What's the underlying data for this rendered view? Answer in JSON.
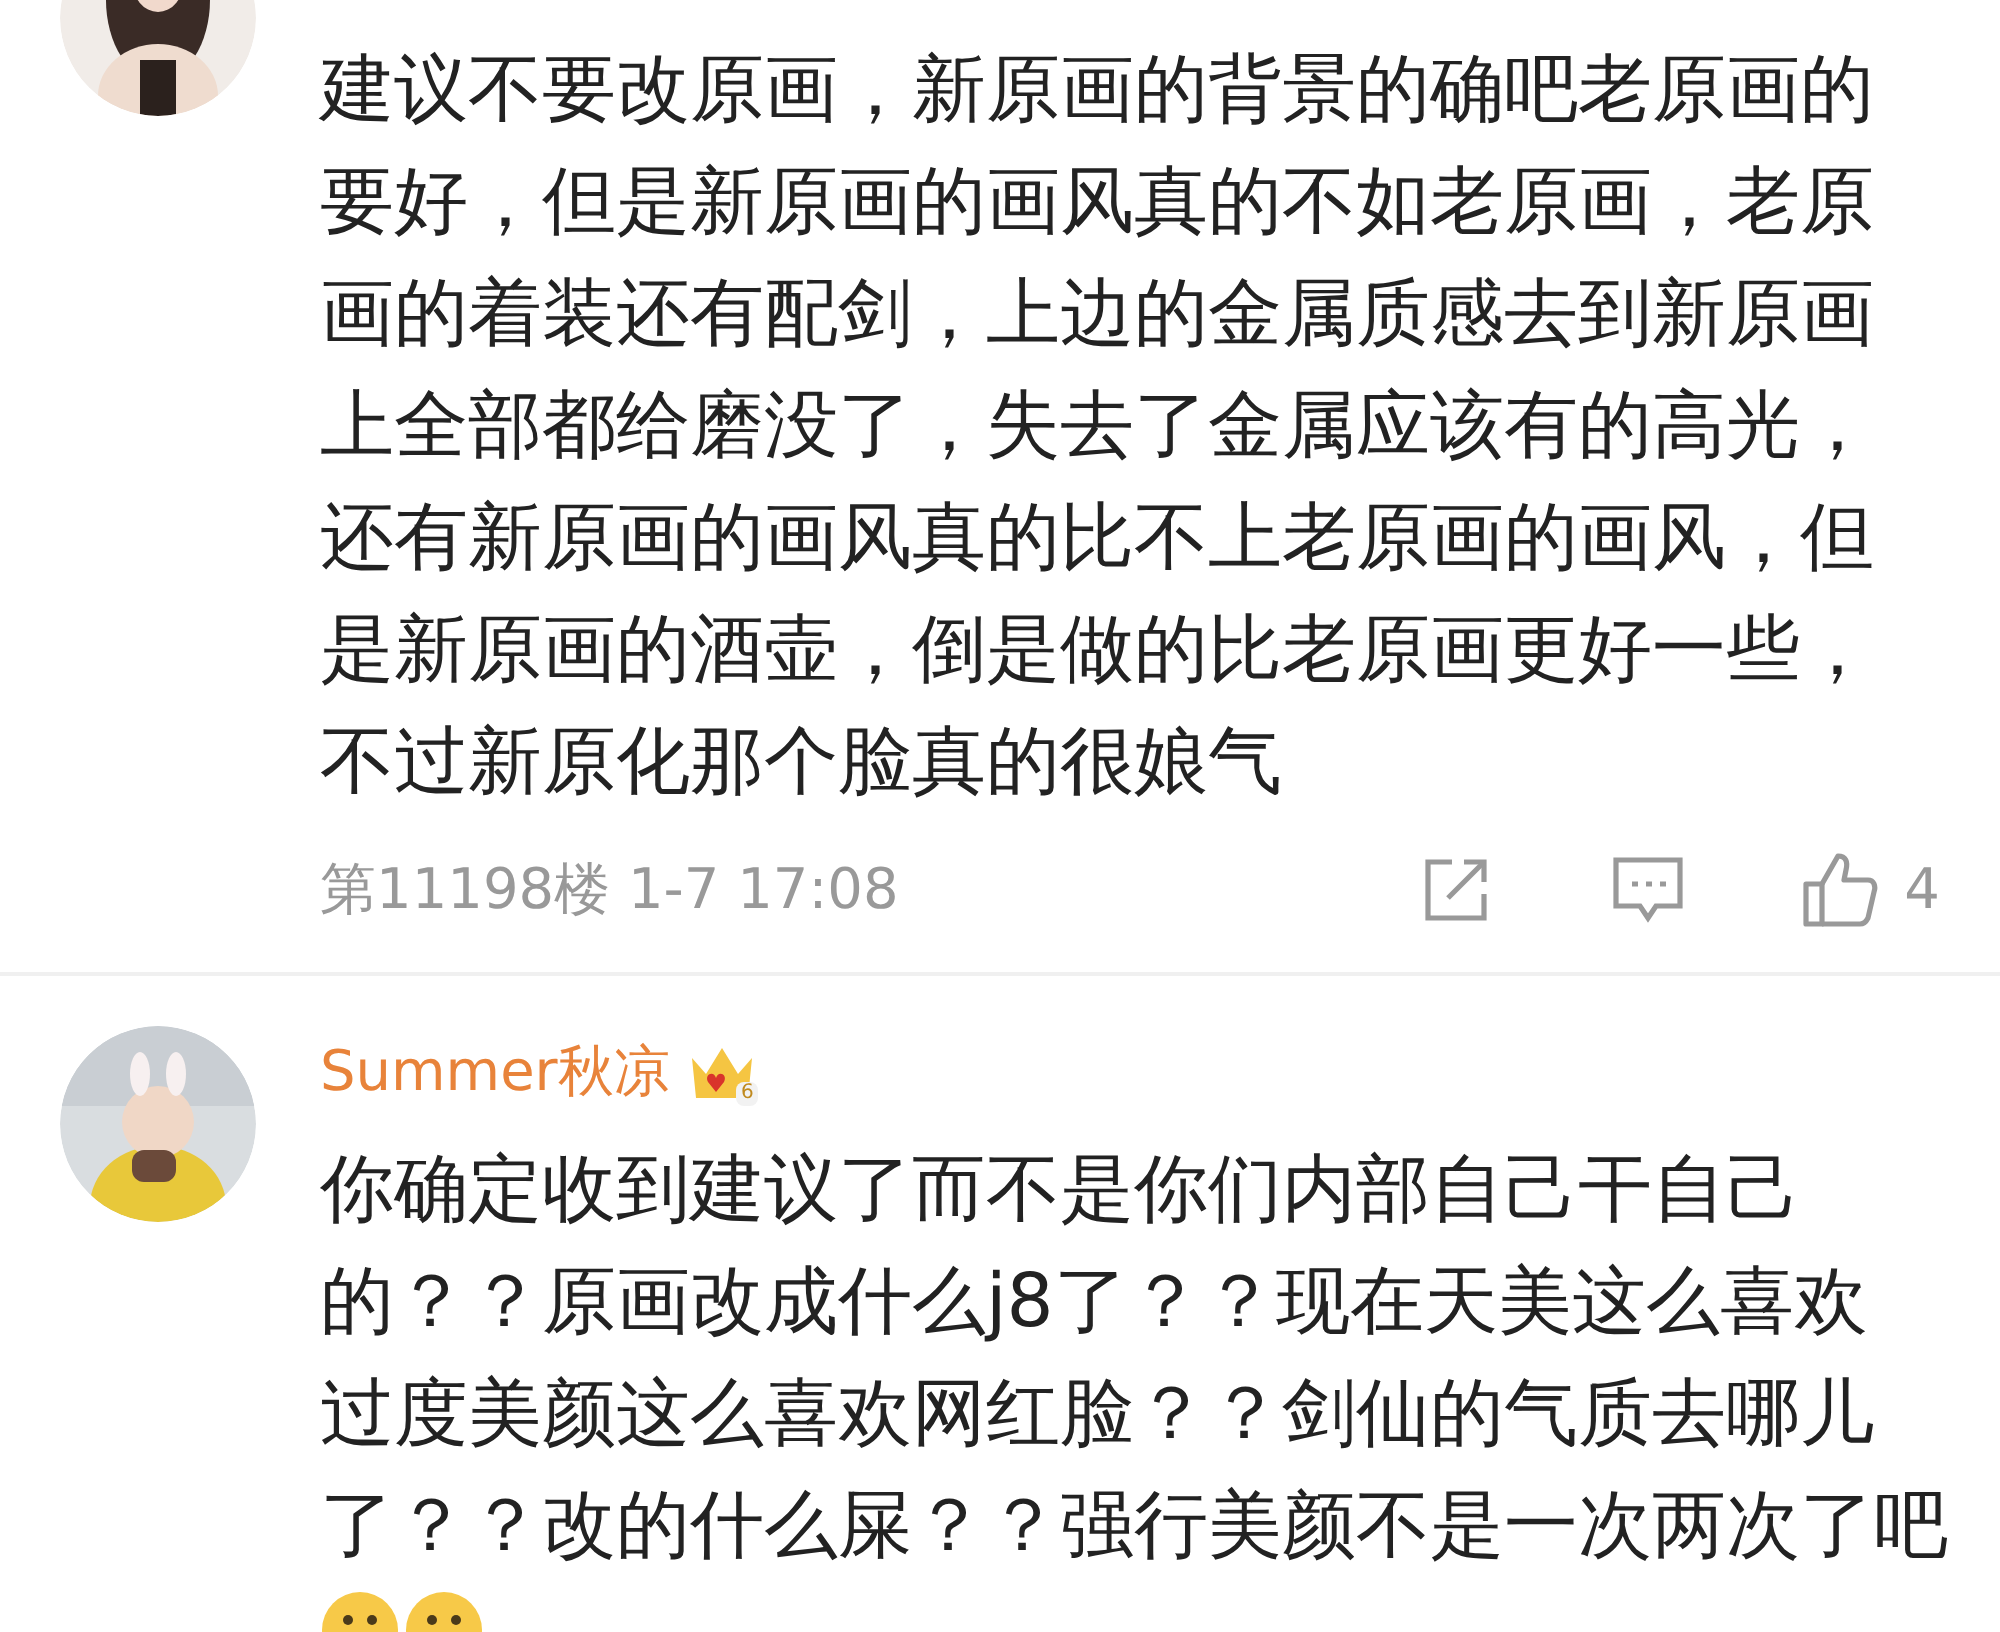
{
  "comments": [
    {
      "lines": [
        "建议不要改原画，新原画的背景的确吧老原画的",
        "要好，但是新原画的画风真的不如老原画，老原",
        "画的着装还有配剑，上边的金属质感去到新原画",
        "上全部都给磨没了，失去了金属应该有的高光，",
        "还有新原画的画风真的比不上老原画的画风，但",
        "是新原画的酒壶，倒是做的比老原画更好一些，",
        "不过新原化那个脸真的很娘气"
      ],
      "meta": {
        "floor_time": "第11198楼 1-7 17:08",
        "likes": "4"
      }
    },
    {
      "username": "Summer秋凉",
      "level_badge": "6",
      "lines": [
        "你确定收到建议了而不是你们内部自己干自己",
        "的？？原画改成什么j8了？？现在天美这么喜欢",
        "过度美颜这么喜欢网红脸？？剑仙的气质去哪儿",
        "了？？改的什么屎？？强行美颜不是一次两次了吧"
      ],
      "emojis": [
        {
          "kind": "face"
        },
        {
          "kind": "face"
        }
      ]
    }
  ]
}
